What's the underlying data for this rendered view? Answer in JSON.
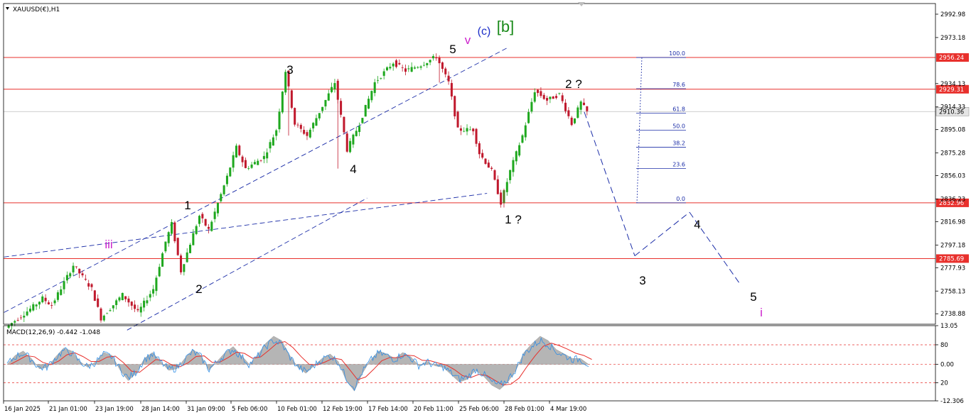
{
  "header": {
    "symbol_label": "XAUUSD(€),H1",
    "macd_label": "MACD(12,26,9) -0.442 -1.048"
  },
  "colors": {
    "bull": "#1fa81f",
    "bear": "#c0192d",
    "level": "#e8302c",
    "trend": "#1c2ea8",
    "macd_fill": "#b5b5b5",
    "macd_signal": "#e8302c",
    "macd_line": "#2f8ee6"
  },
  "chart_data": [
    {
      "type": "candlestick",
      "title": "XAUUSD(€),H1",
      "ylim": [
        2730,
        3002
      ],
      "y_ticks": [
        "2992.98",
        "2973.18",
        "2934.13",
        "2914.33",
        "2895.08",
        "2875.28",
        "2856.03",
        "2836.23",
        "2816.98",
        "2797.18",
        "2777.93",
        "2758.13",
        "2738.88"
      ],
      "x_ticks": [
        "16 Jan 2025",
        "21 Jan 01:00",
        "23 Jan 19:00",
        "28 Jan 14:00",
        "31 Jan 09:00",
        "5 Feb 06:00",
        "10 Feb 01:00",
        "12 Feb 19:00",
        "17 Feb 14:00",
        "20 Feb 11:00",
        "25 Feb 06:00",
        "28 Feb 01:00",
        "4 Mar 19:00"
      ],
      "current_price": "2910.36",
      "horizontal_levels": [
        {
          "value": 2956.24,
          "label": "2956.24"
        },
        {
          "value": 2929.31,
          "label": "2929.31"
        },
        {
          "value": 2832.96,
          "label": "2832.96"
        },
        {
          "value": 2785.69,
          "label": "2785.69"
        }
      ],
      "fibonacci": [
        {
          "level": "100.0",
          "price": 2956.24
        },
        {
          "level": "78.6",
          "price": 2929.8
        },
        {
          "level": "61.8",
          "price": 2909.1
        },
        {
          "level": "50.0",
          "price": 2894.6
        },
        {
          "level": "38.2",
          "price": 2880.1
        },
        {
          "level": "23.6",
          "price": 2862.1
        },
        {
          "level": "0.0",
          "price": 2832.96
        }
      ],
      "price_path": [
        [
          0,
          2727
        ],
        [
          9,
          2745
        ],
        [
          12,
          2752
        ],
        [
          15,
          2746
        ],
        [
          22,
          2780
        ],
        [
          28,
          2760
        ],
        [
          31,
          2735
        ],
        [
          38,
          2755
        ],
        [
          43,
          2740
        ],
        [
          48,
          2760
        ],
        [
          52,
          2800
        ],
        [
          54,
          2815
        ],
        [
          57,
          2775
        ],
        [
          63,
          2822
        ],
        [
          66,
          2810
        ],
        [
          72,
          2855
        ],
        [
          75,
          2880
        ],
        [
          78,
          2862
        ],
        [
          84,
          2872
        ],
        [
          88,
          2895
        ],
        [
          91,
          2945
        ],
        [
          94,
          2900
        ],
        [
          98,
          2890
        ],
        [
          102,
          2910
        ],
        [
          107,
          2935
        ],
        [
          111,
          2878
        ],
        [
          115,
          2900
        ],
        [
          120,
          2935
        ],
        [
          126,
          2952
        ],
        [
          130,
          2945
        ],
        [
          135,
          2950
        ],
        [
          140,
          2957
        ],
        [
          144,
          2935
        ],
        [
          147,
          2895
        ],
        [
          152,
          2895
        ],
        [
          154,
          2875
        ],
        [
          158,
          2860
        ],
        [
          161,
          2833
        ],
        [
          164,
          2860
        ],
        [
          168,
          2890
        ],
        [
          172,
          2928
        ],
        [
          176,
          2920
        ],
        [
          180,
          2925
        ],
        [
          184,
          2900
        ],
        [
          187,
          2918
        ],
        [
          189,
          2910
        ]
      ],
      "projection": [
        {
          "label": "",
          "value": 2910
        },
        {
          "label": "3",
          "value": 2788
        },
        {
          "label": "4",
          "value": 2825
        },
        {
          "label": "5",
          "value": 2765
        }
      ],
      "wave_labels": [
        "1",
        "2",
        "iii",
        "3",
        "4",
        "5",
        "v",
        "(c)",
        "[b]",
        "1 ?",
        "2 ?",
        "3",
        "4",
        "5",
        "i"
      ]
    },
    {
      "type": "line",
      "title": "MACD(12,26,9) -0.442 -1.048",
      "ylim": [
        -12.306,
        13.05
      ],
      "y_ticks": [
        "13.05",
        "80",
        "0.00",
        "20",
        "-12.306"
      ],
      "series": [
        {
          "values": [
            0.0,
            3.0,
            4.5,
            2.0,
            -1.5,
            -1.0,
            2.5,
            5.5,
            4.5,
            1.0,
            -1.0,
            1.0,
            4.0,
            3.0,
            -2.0,
            -5.5,
            -3.0,
            2.0,
            4.0,
            1.0,
            -2.0,
            -1.5,
            2.0,
            5.0,
            3.0,
            -2.0,
            1.0,
            4.0,
            6.0,
            3.0,
            0.0,
            3.0,
            7.0,
            9.5,
            8.0,
            3.0,
            -1.0,
            -3.0,
            -0.5,
            2.0,
            3.5,
            1.0,
            -5.5,
            -9.0,
            -3.0,
            1.5,
            4.5,
            3.5,
            2.0,
            4.0,
            2.5,
            -0.5,
            1.0,
            -0.5,
            -1.0,
            -3.5,
            -6.0,
            -5.0,
            -2.0,
            -4.0,
            -7.0,
            -8.5,
            -6.0,
            -2.0,
            4.0,
            7.0,
            9.5,
            8.0,
            5.0,
            3.5,
            2.0,
            2.0,
            0.0
          ]
        }
      ]
    }
  ]
}
